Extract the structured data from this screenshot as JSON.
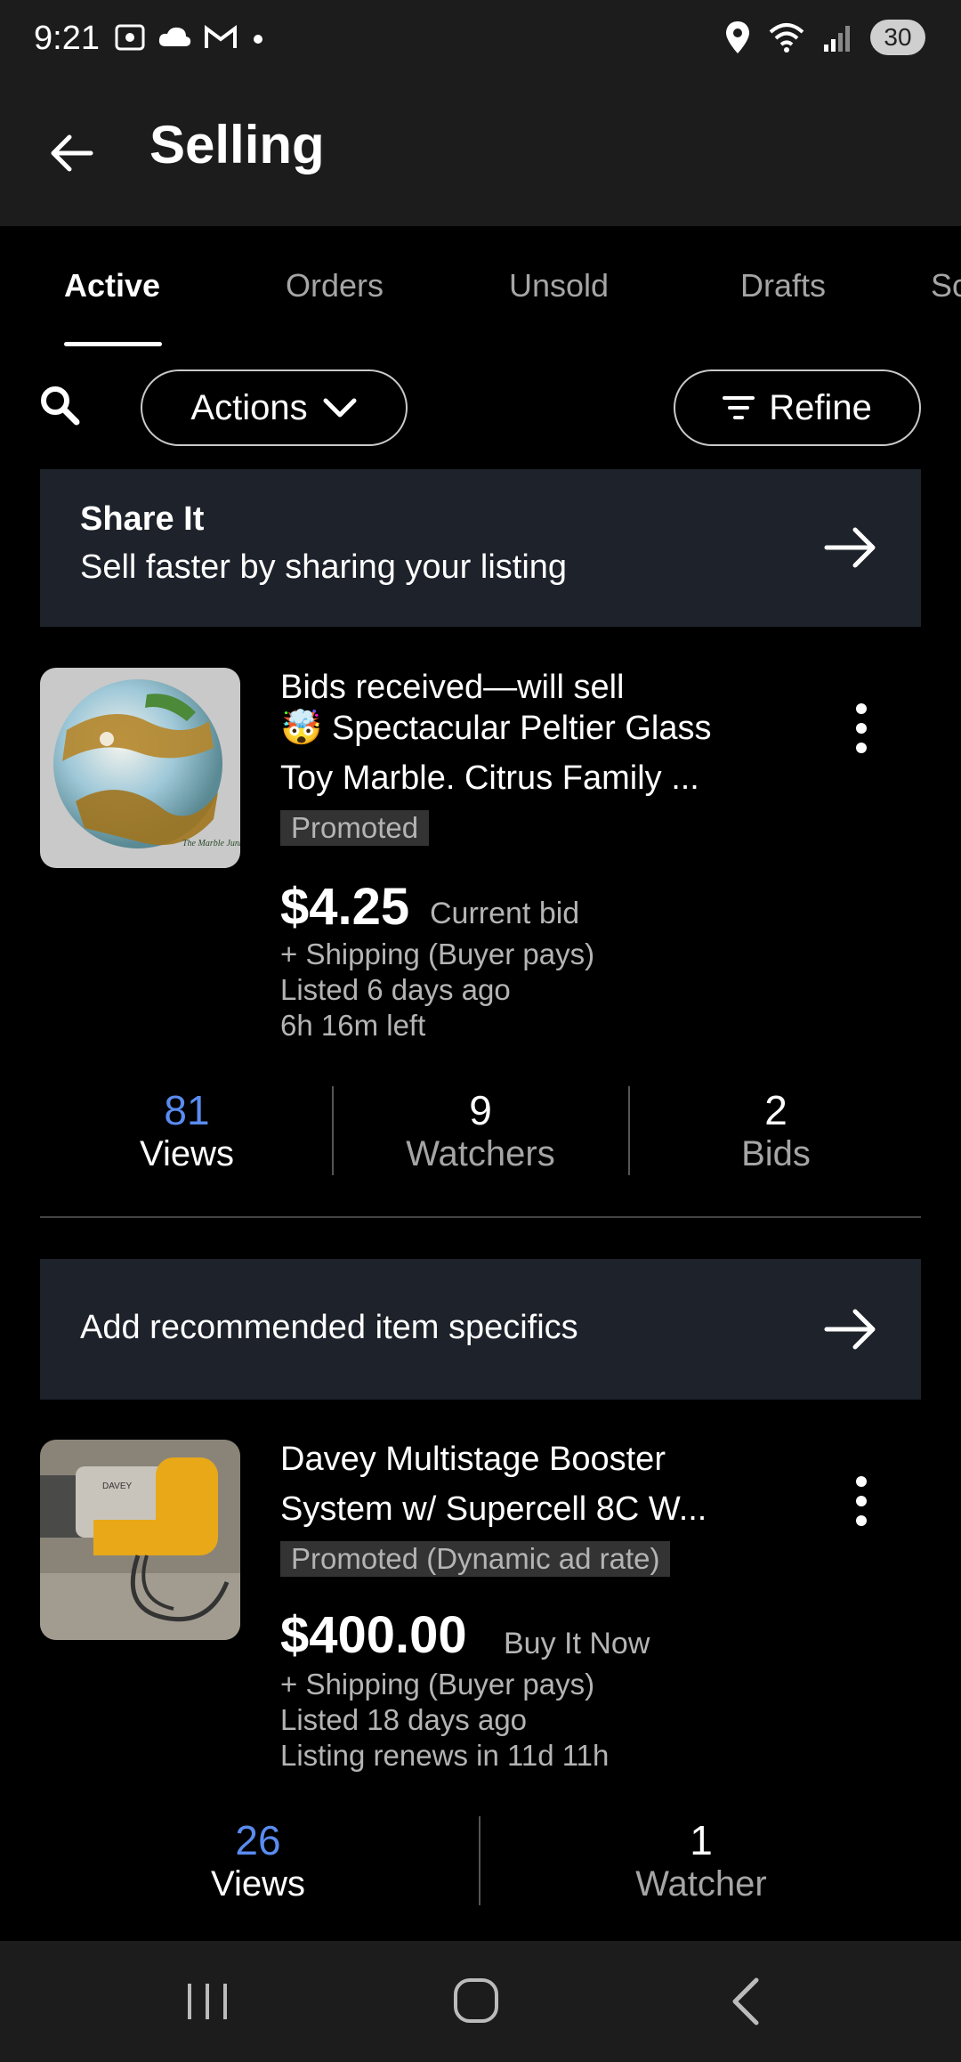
{
  "status_bar": {
    "time": "9:21",
    "battery": "30"
  },
  "header": {
    "title": "Selling"
  },
  "tabs": [
    {
      "label": "Active"
    },
    {
      "label": "Orders"
    },
    {
      "label": "Unsold"
    },
    {
      "label": "Drafts"
    },
    {
      "label": "Sc"
    }
  ],
  "filters": {
    "actions_label": "Actions",
    "refine_label": "Refine"
  },
  "share_banner": {
    "title": "Share It",
    "subtitle": "Sell faster by sharing your listing"
  },
  "listings": [
    {
      "title_lines": [
        "Bids received—will sell",
        "🤯 Spectacular Peltier Glass",
        "Toy Marble. Citrus Family ..."
      ],
      "tag": "Promoted",
      "price": "$4.25",
      "price_note": "Current bid",
      "shipping": "+ Shipping (Buyer pays)",
      "listed": "Listed 6 days ago",
      "time_left": "6h 16m left",
      "image_text": "The Marble Junkie",
      "stats": [
        {
          "value": "81",
          "label": "Views"
        },
        {
          "value": "9",
          "label": "Watchers"
        },
        {
          "value": "2",
          "label": "Bids"
        }
      ]
    },
    {
      "title_lines": [
        "Davey Multistage Booster",
        "System w/ Supercell 8C W..."
      ],
      "tag": "Promoted (Dynamic ad rate)",
      "price": "$400.00",
      "price_note": "Buy It Now",
      "shipping": "+ Shipping (Buyer pays)",
      "listed": "Listed 18 days ago",
      "time_left": "Listing renews in 11d 11h",
      "image_text": "DAVEY",
      "stats": [
        {
          "value": "26",
          "label": "Views"
        },
        {
          "value": "1",
          "label": "Watcher"
        }
      ]
    }
  ],
  "specifics_banner": {
    "title": "Add recommended item specifics"
  }
}
